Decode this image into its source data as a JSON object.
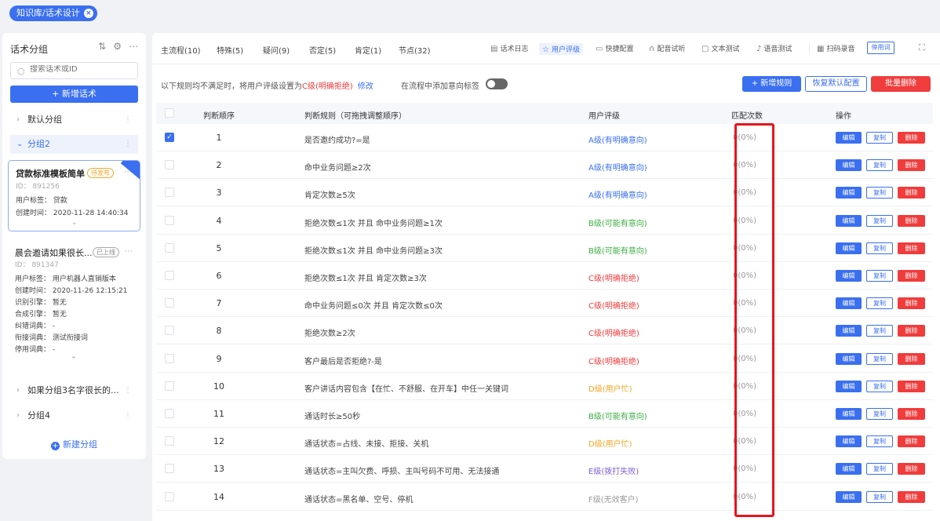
{
  "breadcrumb": {
    "label": "知识库/话术设计",
    "close": "×"
  },
  "sidebar": {
    "title": "话术分组",
    "tool_icons": [
      "sort-icon",
      "gear-icon",
      "more-icon"
    ],
    "search_placeholder": "搜索话术或ID",
    "new_script_label": "+  新增话术",
    "groups": [
      {
        "label": "默认分组",
        "expanded": false
      },
      {
        "label": "分组2",
        "expanded": true
      },
      {
        "label": "如果分组3名字很长的...",
        "expanded": false
      },
      {
        "label": "分组4",
        "expanded": false
      }
    ],
    "card1": {
      "title": "贷款标准模板简单",
      "tag": "待发布",
      "id": "ID：  891256",
      "user_tag": "用户标签：  贷款",
      "created": "创建时间：  2020-11-28 14:40:34"
    },
    "card2": {
      "title": "晨会邀请如果很长...",
      "tag": "已上线",
      "id": "ID：  891347",
      "lines": [
        "用户标签：  用户机器人直销版本",
        "创建时间：  2020-11-26 12:15:21",
        "识别引擎：  暂无",
        "合成引擎：  暂无",
        "纠错词典：  -",
        "衔接词典：  测试衔接词",
        "停用词典：  -"
      ]
    },
    "new_group_label": "新建分组"
  },
  "tabs": [
    {
      "label": "主流程(10)"
    },
    {
      "label": "特殊(5)"
    },
    {
      "label": "疑问(9)"
    },
    {
      "label": "否定(5)"
    },
    {
      "label": "肯定(1)"
    },
    {
      "label": "节点(32)"
    }
  ],
  "tools": [
    {
      "label": "话术日志",
      "icon": "log-icon",
      "active": false
    },
    {
      "label": "用户评级",
      "icon": "star-icon",
      "active": true
    },
    {
      "label": "快捷配置",
      "icon": "config-icon",
      "active": false
    },
    {
      "label": "配音试听",
      "icon": "headphone-icon",
      "active": false
    },
    {
      "label": "文本测试",
      "icon": "chat-icon",
      "active": false
    },
    {
      "label": "语音测试",
      "icon": "mic-icon",
      "active": false
    },
    {
      "label": "扫码录音",
      "icon": "qrcode-icon",
      "active": false
    }
  ],
  "stop_words_button": "停用词",
  "rule_text": {
    "prefix": "以下规则均不满足时，将用户评级设置为",
    "level": "C级(明确拒绝)",
    "edit": "修改"
  },
  "toggle_label": "在流程中添加意向标签",
  "toggle_on": false,
  "buttons": {
    "add": "+  新增规则",
    "restore": "恢复默认配置",
    "batch_delete": "批量删除"
  },
  "columns": [
    "判断顺序",
    "判断规则（可拖拽调整顺序）",
    "用户评级",
    "匹配次数",
    "操作"
  ],
  "actions": {
    "edit": "编辑",
    "copy": "复制",
    "delete": "删除"
  },
  "rows": [
    {
      "no": "1",
      "rule": "是否邀约成功?=是",
      "level": "A级(有明确意向)",
      "color": "#3a6ff0",
      "count": "0(0%)",
      "checked": true
    },
    {
      "no": "2",
      "rule": "命中业务问题≥2次",
      "level": "A级(有明确意向)",
      "color": "#3a6ff0",
      "count": "0(0%)",
      "checked": false
    },
    {
      "no": "3",
      "rule": "肯定次数≥5次",
      "level": "A级(有明确意向)",
      "color": "#3a6ff0",
      "count": "0(0%)",
      "checked": false
    },
    {
      "no": "4",
      "rule": "拒绝次数≤1次  并且  命中业务问题≥1次",
      "level": "B级(可能有意向)",
      "color": "#3cb043",
      "count": "0(0%)",
      "checked": false
    },
    {
      "no": "5",
      "rule": "拒绝次数≤1次  并且  命中业务问题≥3次",
      "level": "B级(可能有意向)",
      "color": "#3cb043",
      "count": "0(0%)",
      "checked": false
    },
    {
      "no": "6",
      "rule": "拒绝次数≤1次  并且  肯定次数≥3次",
      "level": "C级(明确拒绝)",
      "color": "#f03c3c",
      "count": "0(0%)",
      "checked": false
    },
    {
      "no": "7",
      "rule": "命中业务问题≤0次  并且  肯定次数≤0次",
      "level": "C级(明确拒绝)",
      "color": "#f03c3c",
      "count": "0(0%)",
      "checked": false
    },
    {
      "no": "8",
      "rule": "拒绝次数≥2次",
      "level": "C级(明确拒绝)",
      "color": "#f03c3c",
      "count": "0(0%)",
      "checked": false
    },
    {
      "no": "9",
      "rule": "客户最后是否拒绝?-是",
      "level": "C级(明确拒绝)",
      "color": "#f03c3c",
      "count": "0(0%)",
      "checked": false
    },
    {
      "no": "10",
      "rule": "客户讲话内容包含【在忙、不舒服、在开车】中任一关键词",
      "level": "D级(用户忙)",
      "color": "#f5a623",
      "count": "0(0%)",
      "checked": false
    },
    {
      "no": "11",
      "rule": "通话时长≥50秒",
      "level": "B级(可能有意向)",
      "color": "#3cb043",
      "count": "0(0%)",
      "checked": false
    },
    {
      "no": "12",
      "rule": "通话状态=占线、未接、拒接、关机",
      "level": "D级(用户忙)",
      "color": "#f5a623",
      "count": "0(0%)",
      "checked": false
    },
    {
      "no": "13",
      "rule": "通话状态=主叫欠费、呼损、主叫号码不可用、无法接通",
      "level": "E级(拨打失败)",
      "color": "#7b61d9",
      "count": "0(0%)",
      "checked": false
    },
    {
      "no": "14",
      "rule": "通话状态=黑名单、空号、停机",
      "level": "F级(无效客户)",
      "color": "#999999",
      "count": "0(0%)",
      "checked": false
    }
  ]
}
